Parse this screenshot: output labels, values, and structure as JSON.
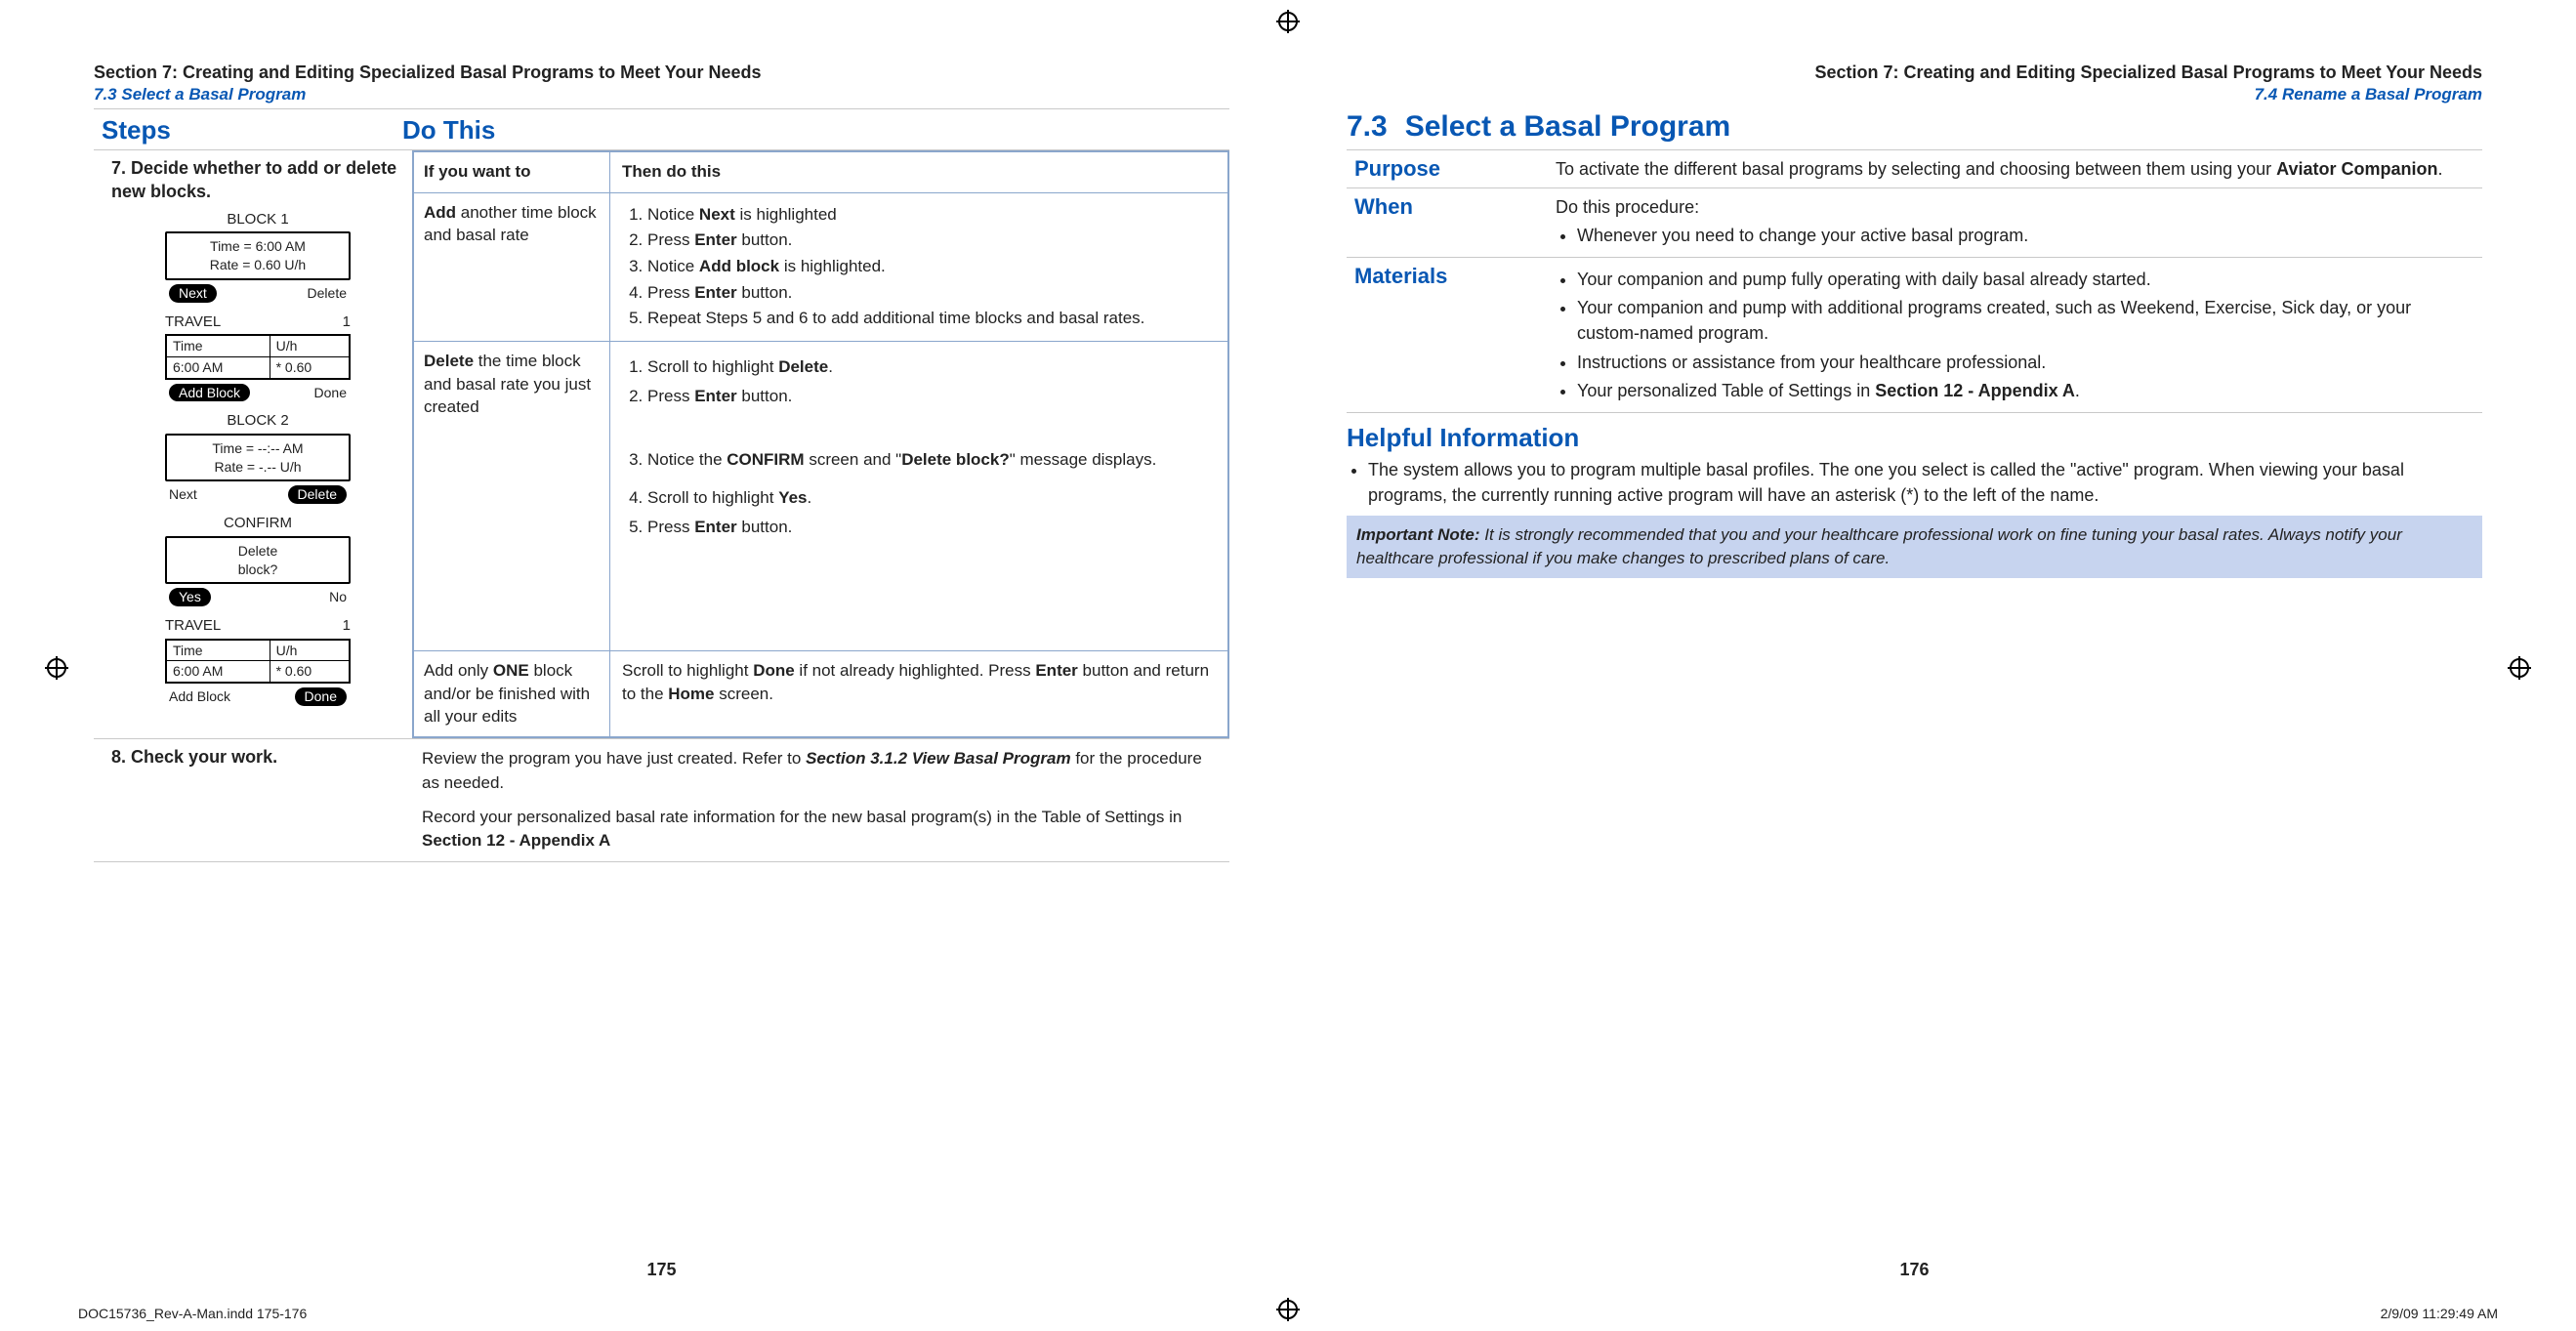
{
  "eyebrow_left_title": "Section 7: Creating and Editing Specialized Basal Programs to Meet Your Needs",
  "eyebrow_left_sub": "7.3 Select a Basal Program",
  "eyebrow_right_title": "Section 7: Creating and Editing Specialized Basal Programs to Meet Your Needs",
  "eyebrow_right_sub": "7.4 Rename a Basal Program",
  "col_steps": "Steps",
  "col_dothis": "Do This",
  "step7_num": "7.",
  "step7_title": "Decide whether to add or delete new blocks.",
  "tbl_h1": "If you want to",
  "tbl_h2": "Then do this",
  "r1_c1_a": "Add",
  "r1_c1_b": " another time block and basal rate",
  "r1_1a": "Notice ",
  "r1_1b": "Next",
  "r1_1c": " is highlighted",
  "r1_2a": "Press ",
  "r1_2b": "Enter",
  "r1_2c": " button.",
  "r1_3a": "Notice ",
  "r1_3b": "Add block",
  "r1_3c": " is highlighted.",
  "r1_4a": "Press ",
  "r1_4b": "Enter",
  "r1_4c": " button.",
  "r1_5": "Repeat Steps 5 and 6 to add additional time blocks and basal rates.",
  "r2_c1_a": "Delete",
  "r2_c1_b": " the time block and basal rate you just created",
  "r2_1a": "Scroll to highlight ",
  "r2_1b": "Delete",
  "r2_1c": ".",
  "r2_2a": "Press ",
  "r2_2b": "Enter",
  "r2_2c": " button.",
  "r2_3a": "Notice the ",
  "r2_3b": "CONFIRM",
  "r2_3c": " screen and \"",
  "r2_3d": "Delete block?",
  "r2_3e": "\" message displays.",
  "r2_4a": "Scroll to highlight ",
  "r2_4b": "Yes",
  "r2_4c": ".",
  "r2_5a": "Press ",
  "r2_5b": "Enter",
  "r2_5c": " button.",
  "r3_c1_a": "Add only ",
  "r3_c1_b": "ONE",
  "r3_c1_c": " block and/or be finished with all your edits",
  "r3_t1": "Scroll to highlight ",
  "r3_t2": "Done",
  "r3_t3": " if not already highlighted. Press ",
  "r3_t4": "Enter",
  "r3_t5": " button and return to the ",
  "r3_t6": "Home",
  "r3_t7": " screen.",
  "step8_num": "8.",
  "step8_title": "Check your work.",
  "step8_p1a": "Review the program you have just created. Refer to ",
  "step8_p1b": "Section 3.1.2 View Basal Program",
  "step8_p1c": " for the procedure as needed.",
  "step8_p2a": "Record your personalized basal rate information for the new basal program(s) in the Table of Settings in ",
  "step8_p2b": "Section 12 - Appendix A",
  "dev_block1": "BLOCK 1",
  "dev_b1_time": "Time = 6:00 AM",
  "dev_b1_rate": "Rate = 0.60 U/h",
  "dev_next": "Next",
  "dev_delete": "Delete",
  "dev_travel": "TRAVEL",
  "dev_travel_idx": "1",
  "dev_th_time": "Time",
  "dev_th_uh": "U/h",
  "dev_td_time": "6:00 AM",
  "dev_td_uh": "* 0.60",
  "dev_addblock": "Add Block",
  "dev_done": "Done",
  "dev_block2": "BLOCK 2",
  "dev_b2_time": "Time = --:-- AM",
  "dev_b2_rate": "Rate = -.-- U/h",
  "dev_confirm": "CONFIRM",
  "dev_confirm_l1": "Delete",
  "dev_confirm_l2": "block?",
  "dev_yes": "Yes",
  "dev_no": "No",
  "pageno_left": "175",
  "pageno_right": "176",
  "h73_num": "7.3",
  "h73_title": "Select a Basal Program",
  "purpose_label": "Purpose",
  "purpose_text_a": "To activate the different basal programs by selecting and choosing between them using your ",
  "purpose_text_b": "Aviator Companion",
  "purpose_text_c": ".",
  "when_label": "When",
  "when_lead": "Do this procedure:",
  "when_b1": "Whenever you need to change your active basal program.",
  "materials_label": "Materials",
  "mat_b1": "Your companion and pump fully operating with daily basal already started.",
  "mat_b2": "Your companion and pump with additional programs created, such as Weekend, Exercise, Sick day, or your custom-named program.",
  "mat_b3": "Instructions or assistance from your healthcare professional.",
  "mat_b4a": "Your personalized Table of Settings in ",
  "mat_b4b": "Section 12 - Appendix A",
  "mat_b4c": ".",
  "helpful_heading": "Helpful Information",
  "helpful_b1": "The system allows you to program multiple basal profiles. The one you select is called the \"active\" program. When viewing your basal programs, the currently running active program will have an asterisk (*) to the left of the name.",
  "note_lead": "Important Note:",
  "note_body": " It is strongly recommended that you and your healthcare professional work on fine tuning your basal rates. Always notify your healthcare professional if you make changes to prescribed plans of care.",
  "footer_file": "DOC15736_Rev-A-Man.indd   175-176",
  "footer_stamp": "2/9/09   11:29:49 AM"
}
